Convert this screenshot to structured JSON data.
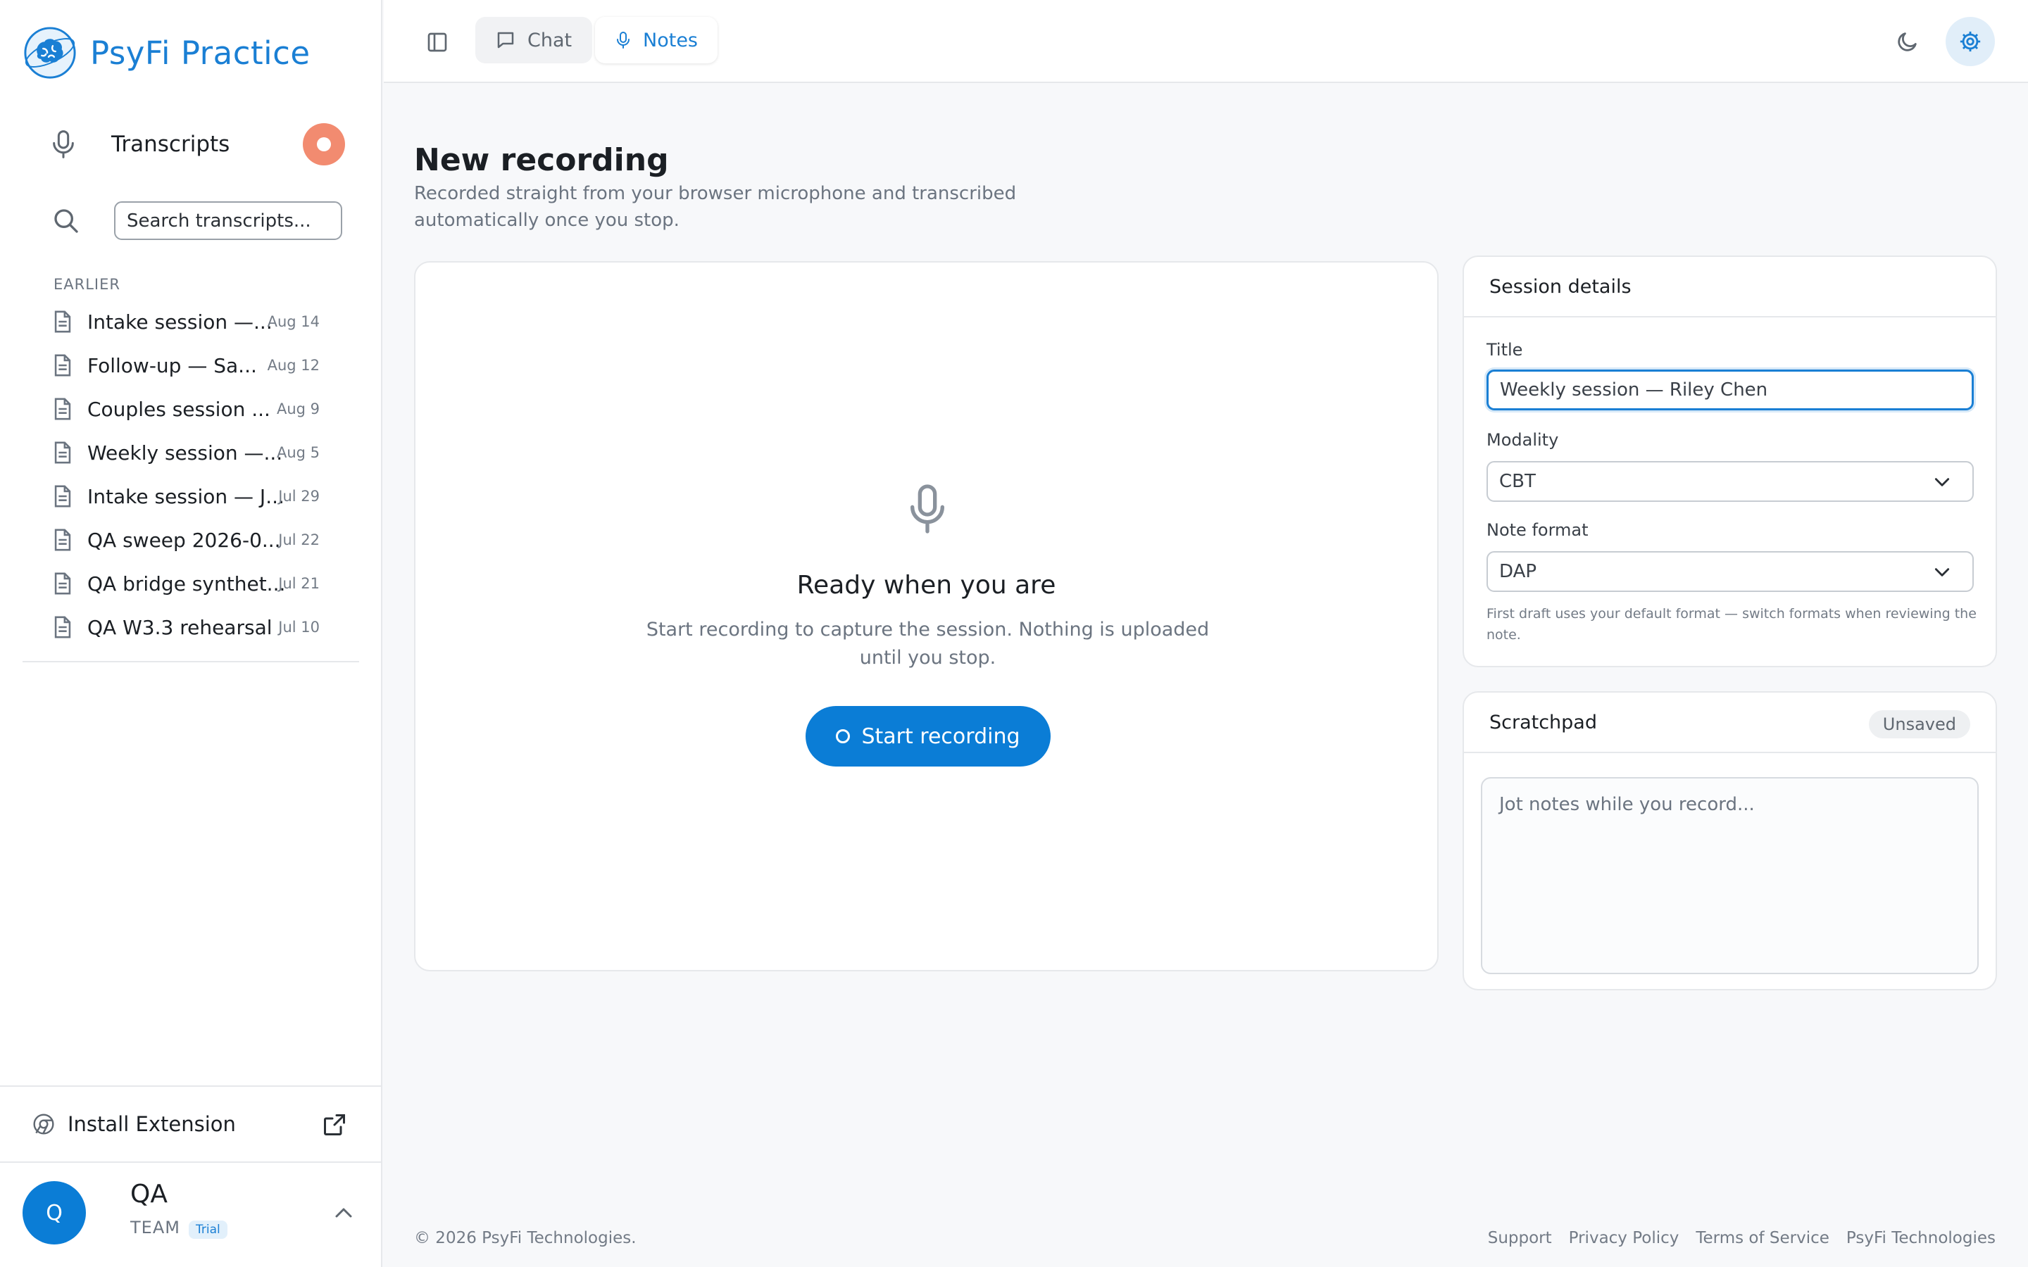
{
  "brand": {
    "name": "PsyFi Practice"
  },
  "sidebar": {
    "transcripts_label": "Transcripts",
    "search_placeholder": "Search transcripts...",
    "section_label": "EARLIER",
    "items": [
      {
        "title": "Intake session —...",
        "date": "Aug 14"
      },
      {
        "title": "Follow-up — Sa...",
        "date": "Aug 12"
      },
      {
        "title": "Couples session ...",
        "date": "Aug 9"
      },
      {
        "title": "Weekly session —...",
        "date": "Aug 5"
      },
      {
        "title": "Intake session — J...",
        "date": "Jul 29"
      },
      {
        "title": "QA sweep 2026-0...",
        "date": "Jul 22"
      },
      {
        "title": "QA bridge synthet...",
        "date": "Jul 21"
      },
      {
        "title": "QA W3.3 rehearsal",
        "date": "Jul 10"
      }
    ],
    "install_extension": "Install Extension",
    "user": {
      "initial": "Q",
      "name": "QA",
      "team": "TEAM",
      "badge": "Trial"
    }
  },
  "topbar": {
    "tabs": [
      {
        "label": "Chat",
        "active": false
      },
      {
        "label": "Notes",
        "active": true
      }
    ]
  },
  "page": {
    "title": "New recording",
    "subtitle": "Recorded straight from your browser microphone and transcribed automatically once you stop."
  },
  "recorder": {
    "title": "Ready when you are",
    "subtitle": "Start recording to capture the session. Nothing is uploaded until you stop.",
    "button": "Start recording"
  },
  "details": {
    "heading": "Session details",
    "title_label": "Title",
    "title_value": "Weekly session — Riley Chen",
    "modality_label": "Modality",
    "modality_value": "CBT",
    "format_label": "Note format",
    "format_value": "DAP",
    "hint": "First draft uses your default format — switch formats when reviewing the note."
  },
  "scratchpad": {
    "heading": "Scratchpad",
    "status": "Unsaved",
    "placeholder": "Jot notes while you record..."
  },
  "footer": {
    "copyright": "© 2026 PsyFi Technologies.",
    "links": [
      "Support",
      "Privacy Policy",
      "Terms of Service",
      "PsyFi Technologies"
    ]
  },
  "colors": {
    "accent": "#0b7dd6",
    "record": "#f28b70",
    "background": "#f7f8fa"
  }
}
